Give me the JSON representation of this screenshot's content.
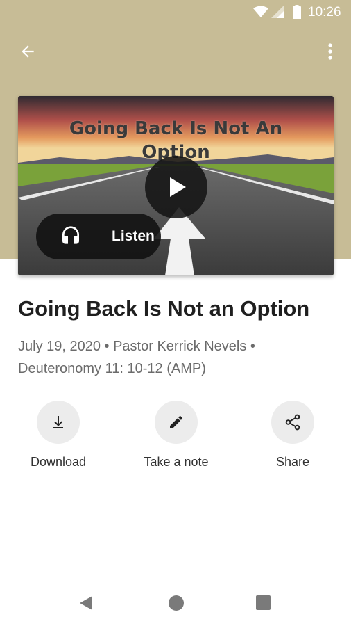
{
  "status_bar": {
    "time": "10:26",
    "icons": [
      "wifi-icon",
      "signal-icon",
      "battery-icon"
    ]
  },
  "app_bar": {
    "back_icon": "arrow-back-icon",
    "menu_icon": "more-vert-icon"
  },
  "hero": {
    "image_title": "Going Back Is Not An Option",
    "play_icon": "play-icon",
    "listen_label": "Listen",
    "listen_icon": "headphones-icon"
  },
  "sermon": {
    "title": "Going Back Is Not an Option",
    "meta_line1": "July 19, 2020 • Pastor Kerrick Nevels •",
    "meta_line2": "Deuteronomy 11: 10-12 (AMP)"
  },
  "actions": [
    {
      "label": "Download",
      "icon": "download-icon"
    },
    {
      "label": "Take a note",
      "icon": "pencil-icon"
    },
    {
      "label": "Share",
      "icon": "share-icon"
    }
  ],
  "colors": {
    "header": "#c7bc96",
    "accent_dark": "#1f1f1f",
    "action_circle": "#ececec"
  }
}
